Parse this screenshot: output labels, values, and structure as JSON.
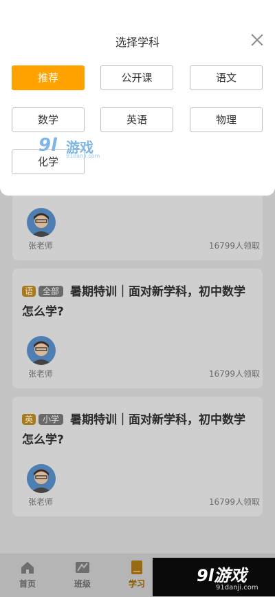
{
  "sheet": {
    "title": "选择学科",
    "subjects": [
      "推荐",
      "公开课",
      "语文",
      "数学",
      "英语",
      "物理",
      "化学"
    ],
    "active_index": 0
  },
  "cards": [
    {
      "teacher": "张老师",
      "count": "16799人领取"
    },
    {
      "subject_tag": "语",
      "level_tag": "全部",
      "title": "暑期特训｜面对新学科，初中数学怎么学?",
      "teacher": "张老师",
      "count": "16799人领取"
    },
    {
      "subject_tag": "英",
      "level_tag": "小学",
      "title": "暑期特训｜面对新学科，初中数学怎么学?",
      "teacher": "张老师",
      "count": "16799人领取"
    }
  ],
  "nav": {
    "items": [
      "首页",
      "班级",
      "学习"
    ],
    "active_index": 2
  },
  "watermark": {
    "logo": "9l",
    "brand": "游戏",
    "url": "91danji.com"
  },
  "colors": {
    "accent": "#ffa200"
  }
}
